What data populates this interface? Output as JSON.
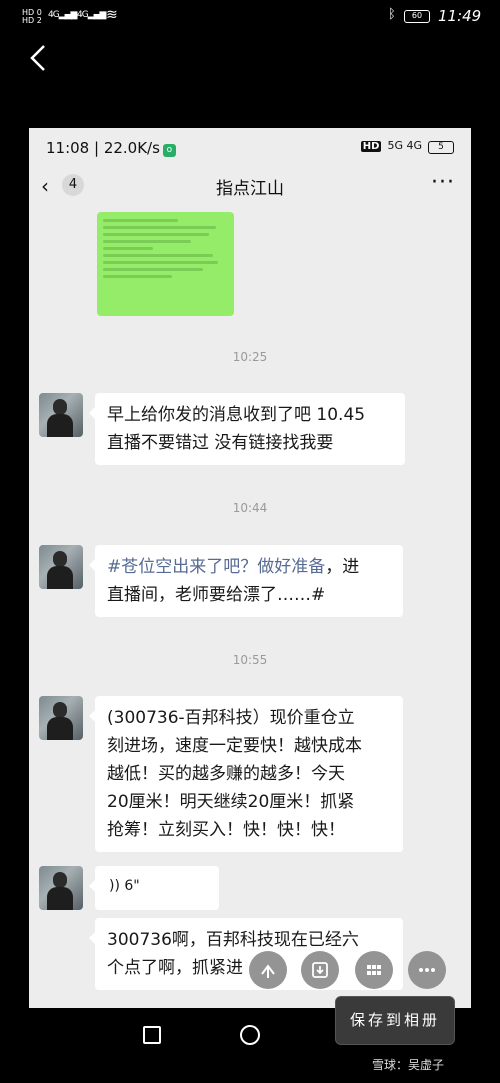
{
  "outer_status": {
    "net1": "HD 0",
    "net2": "HD 2",
    "sig1": "4G",
    "sig2": "4G",
    "battery": "60",
    "time": "11:49"
  },
  "inner_status": {
    "time_speed": "11:08 | 22.0K/s",
    "app_dot": "o",
    "hd": "HD",
    "net": "5G 4G",
    "battery": "5"
  },
  "chat": {
    "back_count": "4",
    "title": "指点江山",
    "more": "···"
  },
  "messages": [
    {
      "time": "10:25",
      "text": "早上给你发的消息收到了吧  10.45\n直播不要错过  没有链接找我要"
    },
    {
      "time": "10:44",
      "link_text": "#苍位空出来了吧？做好准备",
      "text": "，进\n直播间，老师要给漂了……#"
    },
    {
      "time": "10:55",
      "text": "(300736-百邦科技）现价重仓立\n刻进场，速度一定要快！越快成本\n越低！买的越多赚的越多！今天\n20厘米！明天继续20厘米！抓紧\n抢筹！立刻买入！快！快！快！"
    },
    {
      "voice": "6\""
    },
    {
      "text": "300736啊，百邦科技现在已经六\n个点了啊，抓紧进"
    }
  ],
  "actions": {
    "save_label": "保存到相册"
  },
  "watermark": "雪球：吴虚子"
}
